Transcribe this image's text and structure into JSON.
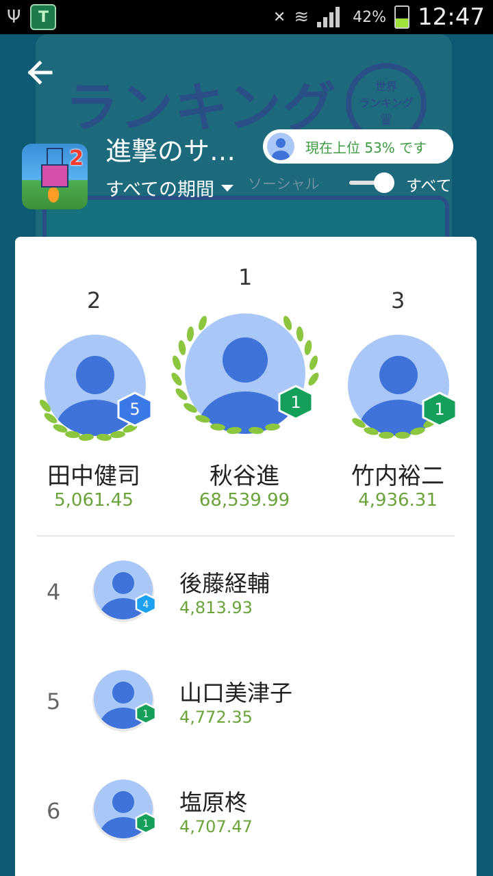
{
  "status_bar": {
    "battery_percent": "42%",
    "time": "12:47",
    "battery_level": 0.42
  },
  "background": {
    "title": "ランキング",
    "badge_line1": "世界",
    "badge_line2": "ランキング"
  },
  "header": {
    "game_title": "進撃のサ…",
    "game_icon_number": "2",
    "period_label": "すべての期間",
    "rank_status": "現在上位 53% です",
    "filter_social": "ソーシャル",
    "filter_all": "すべて"
  },
  "podium": [
    {
      "rank": "2",
      "name": "田中健司",
      "score": "5,061.45",
      "level": "5",
      "level_color": "#3b78e7"
    },
    {
      "rank": "1",
      "name": "秋谷進",
      "score": "68,539.99",
      "level": "1",
      "level_color": "#14a05a"
    },
    {
      "rank": "3",
      "name": "竹内裕二",
      "score": "4,936.31",
      "level": "1",
      "level_color": "#14a05a"
    }
  ],
  "list": [
    {
      "rank": "4",
      "name": "後藤経輔",
      "score": "4,813.93",
      "level": "4",
      "level_color": "#1ea0f0"
    },
    {
      "rank": "5",
      "name": "山口美津子",
      "score": "4,772.35",
      "level": "1",
      "level_color": "#14a05a"
    },
    {
      "rank": "6",
      "name": "塩原柊",
      "score": "4,707.47",
      "level": "1",
      "level_color": "#14a05a"
    }
  ],
  "colors": {
    "score_green": "#6aa33a",
    "avatar_bg": "#a9c7f7",
    "avatar_fg": "#3f73d9",
    "laurel": "#8cc63f"
  }
}
